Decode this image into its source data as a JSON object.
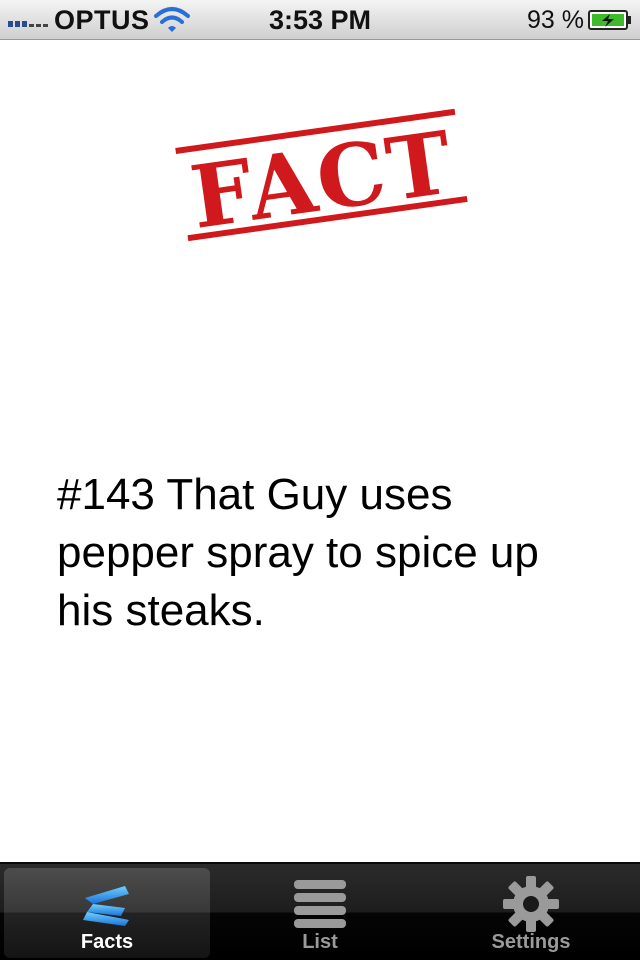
{
  "status_bar": {
    "carrier": "OPTUS",
    "time": "3:53 PM",
    "battery_percent": "93 %",
    "signal_icon": "signal-bars-icon",
    "wifi_icon": "wifi-icon",
    "battery_icon": "battery-charging-icon"
  },
  "content": {
    "stamp": {
      "text": "FACT",
      "color": "#d0191c"
    },
    "fact_text": "#143 That Guy uses pepper spray to spice up his steaks."
  },
  "tab_bar": {
    "tabs": [
      {
        "label": "Facts",
        "icon": "facts-icon",
        "selected": true
      },
      {
        "label": "List",
        "icon": "list-icon",
        "selected": false
      },
      {
        "label": "Settings",
        "icon": "gear-icon",
        "selected": false
      }
    ]
  }
}
